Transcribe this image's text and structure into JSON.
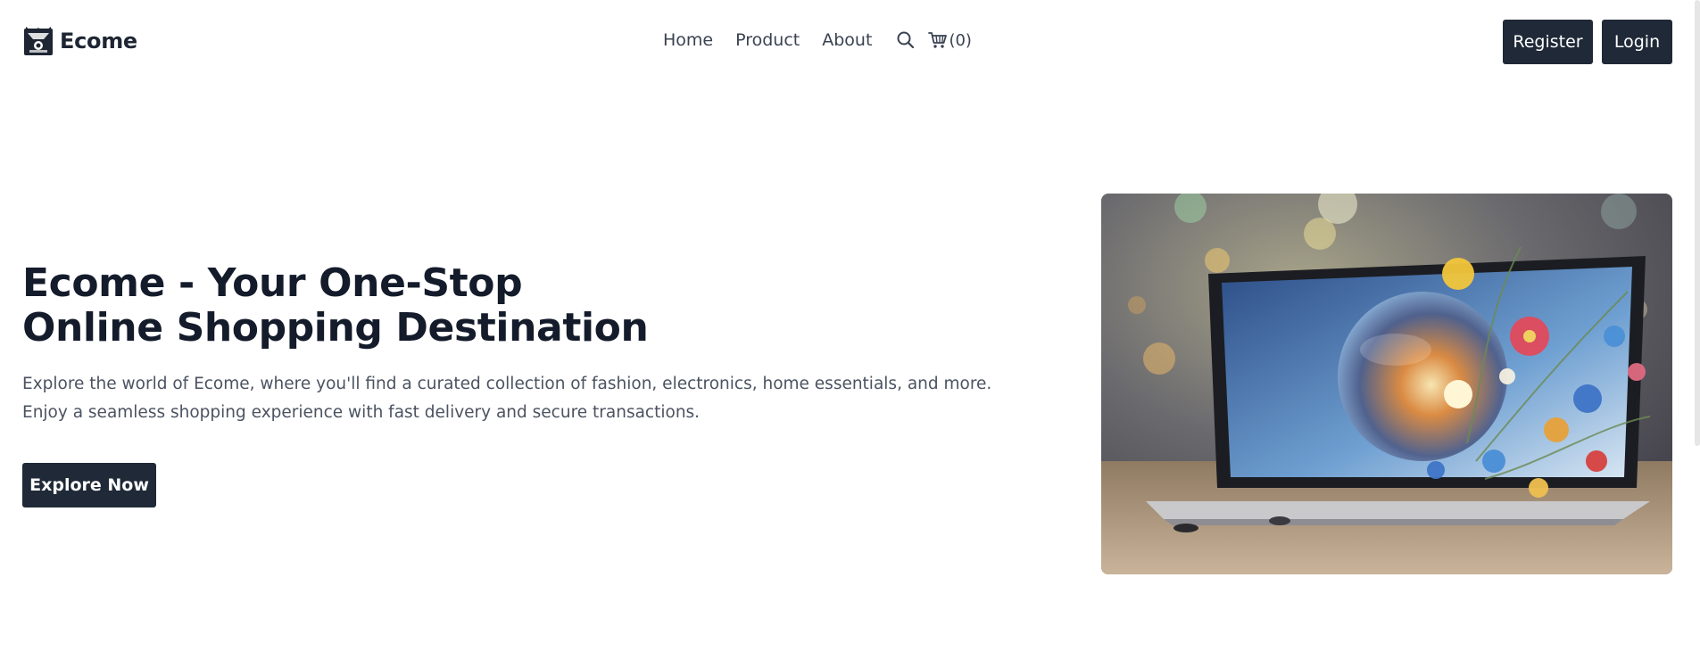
{
  "brand": {
    "name": "Ecome",
    "logo_icon": "ecome-logo-icon"
  },
  "nav": {
    "items": [
      {
        "label": "Home"
      },
      {
        "label": "Product"
      },
      {
        "label": "About"
      }
    ],
    "search_icon": "search-icon",
    "cart_icon": "cart-icon",
    "cart_count": "(0)"
  },
  "auth": {
    "register_label": "Register",
    "login_label": "Login"
  },
  "hero": {
    "title_line1": "Ecome - Your One-Stop",
    "title_line2": "Online Shopping Destination",
    "description": "Explore the world of Ecome, where you'll find a curated collection of fashion, electronics, home essentials, and more. Enjoy a seamless shopping experience with fast delivery and secure transactions.",
    "cta_label": "Explore Now"
  },
  "colors": {
    "primary_dark": "#1f2937",
    "heading": "#141b2b",
    "body_text": "#4b5361"
  }
}
